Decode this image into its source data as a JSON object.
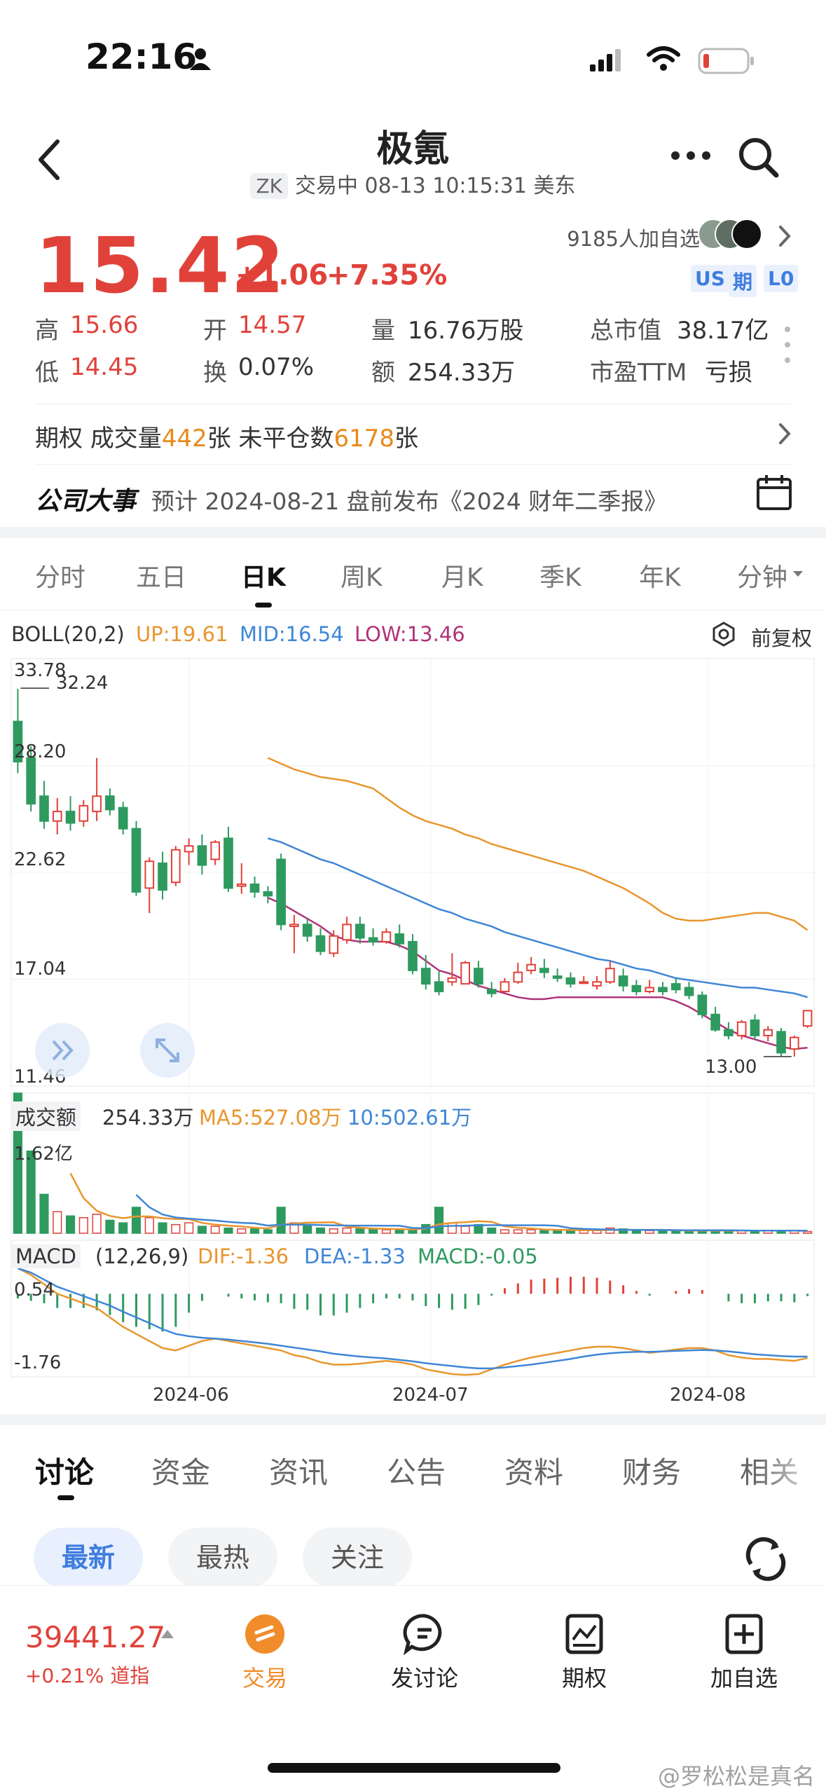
{
  "status_bar": {
    "time": "22:16",
    "icons": [
      "person-icon",
      "signal-icon",
      "wifi-icon",
      "battery-icon"
    ]
  },
  "header": {
    "title": "极氪",
    "ticker_tag": "ZK",
    "trade_status": "交易中 08-13 10:15:31 美东"
  },
  "quote": {
    "price": "15.42",
    "change": "+1.06",
    "change_pct": "+7.35%",
    "watchers": "9185人加自选",
    "badges": [
      "US",
      "期",
      "L0"
    ],
    "stats": [
      {
        "label": "高",
        "value": "15.66",
        "color": "red"
      },
      {
        "label": "开",
        "value": "14.57",
        "color": "red"
      },
      {
        "label": "量",
        "value": "16.76万股",
        "color": "normal"
      },
      {
        "label": "总市值",
        "value": "38.17亿",
        "color": "normal"
      },
      {
        "label": "低",
        "value": "14.45",
        "color": "red"
      },
      {
        "label": "换",
        "value": "0.07%",
        "color": "normal"
      },
      {
        "label": "额",
        "value": "254.33万",
        "color": "normal"
      },
      {
        "label": "市盈TTM",
        "value": "亏损",
        "color": "normal"
      }
    ]
  },
  "options_row": {
    "label": "期权",
    "vol_label": "成交量",
    "vol_value": "442",
    "vol_unit": "张",
    "oi_label": "未平仓数",
    "oi_value": "6178",
    "oi_unit": "张"
  },
  "event_row": {
    "title": "公司大事",
    "text": "预计 2024-08-21 盘前发布《2024 财年二季报》"
  },
  "period_tabs": [
    "分时",
    "五日",
    "日K",
    "周K",
    "月K",
    "季K",
    "年K",
    "分钟"
  ],
  "active_period": "日K",
  "boll": {
    "name": "BOLL(20,2)",
    "up": "UP:19.61",
    "mid": "MID:16.54",
    "low": "LOW:13.46",
    "adjust": "前复权"
  },
  "price_axis": {
    "max": "33.78",
    "high_mark": "32.24",
    "l2": "28.20",
    "l3": "22.62",
    "l4": "17.04",
    "min": "11.46",
    "low_mark": "13.00"
  },
  "turnover": {
    "label": "成交额",
    "value": "254.33万",
    "ma5": "MA5:527.08万",
    "ma10": "10:502.61万",
    "axis_max": "1.62亿"
  },
  "macd": {
    "label": "MACD",
    "params": "(12,26,9)",
    "dif": "DIF:-1.36",
    "dea": "DEA:-1.33",
    "macd": "MACD:-0.05",
    "axis_top": "0.54",
    "axis_bottom": "-1.76"
  },
  "x_axis": [
    "2024-06",
    "2024-07",
    "2024-08"
  ],
  "colors": {
    "up": "#e0423a",
    "down": "#2e9a5f",
    "boll_up": "#e8962e",
    "boll_mid": "#3f86d6",
    "boll_low": "#b0337a"
  },
  "chart_data": {
    "type": "candlestick",
    "title": "",
    "x_range": [
      "2024-05-10",
      "2024-08-13"
    ],
    "ylim": [
      11.46,
      33.78
    ],
    "candles": [
      [
        30.5,
        32.2,
        28.4,
        27.8
      ],
      [
        28.6,
        29.2,
        26.2,
        25.8
      ],
      [
        26.6,
        27.4,
        25.3,
        24.9
      ],
      [
        25.3,
        26.5,
        25.8,
        24.6
      ],
      [
        25.8,
        26.6,
        25.2,
        24.8
      ],
      [
        25.3,
        26.4,
        26.1,
        25.0
      ],
      [
        25.8,
        28.6,
        26.6,
        25.3
      ],
      [
        26.6,
        27.0,
        25.9,
        25.6
      ],
      [
        26.0,
        26.3,
        24.9,
        24.6
      ],
      [
        24.9,
        25.3,
        21.6,
        21.4
      ],
      [
        21.8,
        23.4,
        23.2,
        20.5
      ],
      [
        23.1,
        23.7,
        21.7,
        21.2
      ],
      [
        22.1,
        24.0,
        23.8,
        21.9
      ],
      [
        23.7,
        24.4,
        24.0,
        23.0
      ],
      [
        24.0,
        24.6,
        23.0,
        22.5
      ],
      [
        23.3,
        24.3,
        24.2,
        23.0
      ],
      [
        24.4,
        25.0,
        21.8,
        21.6
      ],
      [
        21.9,
        23.1,
        22.0,
        21.5
      ],
      [
        22.0,
        22.4,
        21.6,
        21.3
      ],
      [
        21.6,
        21.9,
        21.4,
        21.0
      ],
      [
        23.3,
        23.6,
        19.9,
        19.6
      ],
      [
        19.8,
        20.4,
        19.9,
        18.4
      ],
      [
        19.9,
        20.2,
        19.3,
        19.0
      ],
      [
        19.3,
        19.7,
        18.5,
        18.3
      ],
      [
        18.4,
        19.6,
        19.3,
        18.2
      ],
      [
        19.1,
        20.3,
        19.9,
        18.9
      ],
      [
        19.9,
        20.3,
        19.2,
        18.9
      ],
      [
        19.2,
        19.7,
        19.0,
        18.8
      ],
      [
        19.0,
        19.7,
        19.5,
        18.9
      ],
      [
        19.4,
        19.9,
        18.9,
        18.7
      ],
      [
        19.0,
        19.4,
        17.5,
        17.3
      ],
      [
        17.6,
        18.3,
        16.8,
        16.5
      ],
      [
        16.9,
        17.5,
        16.4,
        16.2
      ],
      [
        16.9,
        18.4,
        17.1,
        16.7
      ],
      [
        16.8,
        18.0,
        17.9,
        16.9
      ],
      [
        17.6,
        18.0,
        16.8,
        16.6
      ],
      [
        16.5,
        16.9,
        16.3,
        16.1
      ],
      [
        16.4,
        17.1,
        16.9,
        16.3
      ],
      [
        16.9,
        17.9,
        17.4,
        16.8
      ],
      [
        17.5,
        18.2,
        17.8,
        17.3
      ],
      [
        17.6,
        18.1,
        17.4,
        17.1
      ],
      [
        17.2,
        17.6,
        17.1,
        16.9
      ],
      [
        17.1,
        17.4,
        16.8,
        16.6
      ],
      [
        16.9,
        17.2,
        16.9,
        16.8
      ],
      [
        16.7,
        17.2,
        16.9,
        16.5
      ],
      [
        16.9,
        18.0,
        17.6,
        16.8
      ],
      [
        17.2,
        17.6,
        16.7,
        16.4
      ],
      [
        16.7,
        17.0,
        16.4,
        16.2
      ],
      [
        16.4,
        17.0,
        16.6,
        16.3
      ],
      [
        16.6,
        16.9,
        16.4,
        16.2
      ],
      [
        16.8,
        17.1,
        16.5,
        16.3
      ],
      [
        16.6,
        16.9,
        16.2,
        16.0
      ],
      [
        16.2,
        16.4,
        15.2,
        15.0
      ],
      [
        15.2,
        15.6,
        14.4,
        14.3
      ],
      [
        14.4,
        14.8,
        14.1,
        13.9
      ],
      [
        14.1,
        14.9,
        14.8,
        13.9
      ],
      [
        14.9,
        15.2,
        14.1,
        13.9
      ],
      [
        14.1,
        14.6,
        14.4,
        13.8
      ],
      [
        14.3,
        14.5,
        13.2,
        13.0
      ],
      [
        13.4,
        14.1,
        14.0,
        13.0
      ],
      [
        14.6,
        15.4,
        15.4,
        14.5
      ]
    ],
    "boll_up": [
      null,
      null,
      null,
      null,
      null,
      null,
      null,
      null,
      null,
      null,
      null,
      null,
      null,
      null,
      null,
      null,
      null,
      null,
      null,
      28.6,
      28.3,
      28.0,
      27.8,
      27.6,
      27.5,
      27.4,
      27.2,
      27.0,
      26.5,
      26.0,
      25.6,
      25.3,
      25.1,
      24.9,
      24.6,
      24.4,
      24.1,
      23.9,
      23.7,
      23.5,
      23.3,
      23.1,
      22.9,
      22.7,
      22.4,
      22.1,
      21.8,
      21.4,
      21.0,
      20.5,
      20.2,
      20.1,
      20.1,
      20.2,
      20.3,
      20.4,
      20.5,
      20.5,
      20.3,
      20.1,
      19.6
    ],
    "boll_mid": [
      null,
      null,
      null,
      null,
      null,
      null,
      null,
      null,
      null,
      null,
      null,
      null,
      null,
      null,
      null,
      null,
      null,
      null,
      null,
      24.4,
      24.2,
      23.9,
      23.6,
      23.3,
      23.1,
      22.8,
      22.5,
      22.2,
      21.9,
      21.6,
      21.3,
      21.0,
      20.7,
      20.5,
      20.2,
      20.0,
      19.8,
      19.5,
      19.3,
      19.1,
      18.9,
      18.7,
      18.5,
      18.3,
      18.1,
      18.0,
      17.8,
      17.6,
      17.5,
      17.3,
      17.1,
      17.0,
      16.9,
      16.8,
      16.7,
      16.6,
      16.6,
      16.5,
      16.4,
      16.3,
      16.1
    ],
    "boll_low": [
      null,
      null,
      null,
      null,
      null,
      null,
      null,
      null,
      null,
      null,
      null,
      null,
      null,
      null,
      null,
      null,
      null,
      null,
      null,
      21.3,
      21.0,
      20.6,
      20.2,
      19.8,
      19.3,
      19.1,
      19.0,
      19.0,
      19.0,
      18.8,
      18.5,
      18.0,
      17.5,
      17.3,
      17.0,
      16.7,
      16.5,
      16.3,
      16.1,
      16.0,
      16.0,
      16.1,
      16.1,
      16.1,
      16.1,
      16.1,
      16.1,
      16.1,
      16.1,
      16.1,
      15.9,
      15.6,
      15.2,
      14.8,
      14.4,
      14.1,
      13.9,
      13.7,
      13.5,
      13.4,
      13.46
    ],
    "turnover_ylim": [
      0,
      1.62
    ],
    "turnover_unit": "亿",
    "turnover": [
      1.62,
      0.95,
      0.45,
      0.25,
      0.2,
      0.18,
      0.22,
      0.15,
      0.12,
      0.3,
      0.18,
      0.12,
      0.1,
      0.12,
      0.08,
      0.08,
      0.06,
      0.05,
      0.05,
      0.04,
      0.3,
      0.12,
      0.1,
      0.06,
      0.05,
      0.06,
      0.05,
      0.05,
      0.04,
      0.04,
      0.04,
      0.1,
      0.3,
      0.12,
      0.08,
      0.1,
      0.06,
      0.04,
      0.04,
      0.04,
      0.04,
      0.04,
      0.03,
      0.03,
      0.03,
      0.06,
      0.05,
      0.03,
      0.03,
      0.03,
      0.03,
      0.03,
      0.03,
      0.03,
      0.03,
      0.03,
      0.03,
      0.03,
      0.03,
      0.03,
      0.02
    ],
    "macd_ylim": [
      -1.76,
      0.54
    ],
    "dif": [
      0.54,
      0.4,
      0.2,
      0.0,
      -0.1,
      -0.2,
      -0.3,
      -0.5,
      -0.7,
      -0.85,
      -1.0,
      -1.15,
      -1.2,
      -1.1,
      -1.0,
      -0.95,
      -1.0,
      -1.05,
      -1.1,
      -1.15,
      -1.2,
      -1.3,
      -1.35,
      -1.45,
      -1.5,
      -1.5,
      -1.48,
      -1.45,
      -1.42,
      -1.45,
      -1.5,
      -1.6,
      -1.65,
      -1.7,
      -1.72,
      -1.7,
      -1.6,
      -1.5,
      -1.42,
      -1.35,
      -1.3,
      -1.25,
      -1.2,
      -1.15,
      -1.12,
      -1.12,
      -1.15,
      -1.2,
      -1.25,
      -1.22,
      -1.18,
      -1.15,
      -1.15,
      -1.2,
      -1.3,
      -1.35,
      -1.38,
      -1.38,
      -1.4,
      -1.42,
      -1.36
    ],
    "dea": [
      0.54,
      0.45,
      0.3,
      0.15,
      0.05,
      -0.05,
      -0.15,
      -0.25,
      -0.38,
      -0.5,
      -0.62,
      -0.75,
      -0.85,
      -0.9,
      -0.93,
      -0.95,
      -0.97,
      -1.0,
      -1.03,
      -1.06,
      -1.1,
      -1.14,
      -1.18,
      -1.22,
      -1.27,
      -1.3,
      -1.33,
      -1.35,
      -1.37,
      -1.4,
      -1.43,
      -1.47,
      -1.5,
      -1.53,
      -1.56,
      -1.58,
      -1.58,
      -1.56,
      -1.53,
      -1.5,
      -1.46,
      -1.42,
      -1.38,
      -1.33,
      -1.29,
      -1.26,
      -1.24,
      -1.23,
      -1.23,
      -1.22,
      -1.21,
      -1.2,
      -1.19,
      -1.2,
      -1.22,
      -1.25,
      -1.28,
      -1.3,
      -1.32,
      -1.33,
      -1.33
    ],
    "macd_hist": [
      -0.1,
      -0.15,
      -0.2,
      -0.3,
      -0.3,
      -0.3,
      -0.35,
      -0.45,
      -0.6,
      -0.7,
      -0.75,
      -0.8,
      -0.7,
      -0.4,
      -0.15,
      0.0,
      -0.06,
      -0.1,
      -0.14,
      -0.18,
      -0.2,
      -0.32,
      -0.34,
      -0.46,
      -0.46,
      -0.4,
      -0.3,
      -0.2,
      -0.1,
      -0.1,
      -0.14,
      -0.26,
      -0.3,
      -0.34,
      -0.32,
      -0.24,
      -0.04,
      0.12,
      0.22,
      0.3,
      0.32,
      0.34,
      0.36,
      0.36,
      0.34,
      0.28,
      0.18,
      0.06,
      -0.04,
      0.0,
      0.06,
      0.1,
      0.08,
      0.0,
      -0.16,
      -0.2,
      -0.2,
      -0.16,
      -0.16,
      -0.18,
      -0.05
    ]
  },
  "detail_tabs": [
    "讨论",
    "资金",
    "资讯",
    "公告",
    "资料",
    "财务",
    "相关"
  ],
  "active_detail_tab": "讨论",
  "filter_pills": [
    "最新",
    "最热",
    "关注"
  ],
  "bottom_bar": {
    "index_value": "39441.27",
    "index_change": "+0.21%",
    "index_name": "道指",
    "items": [
      "交易",
      "发讨论",
      "期权",
      "加自选"
    ]
  },
  "watermark": "@罗松松是真名"
}
